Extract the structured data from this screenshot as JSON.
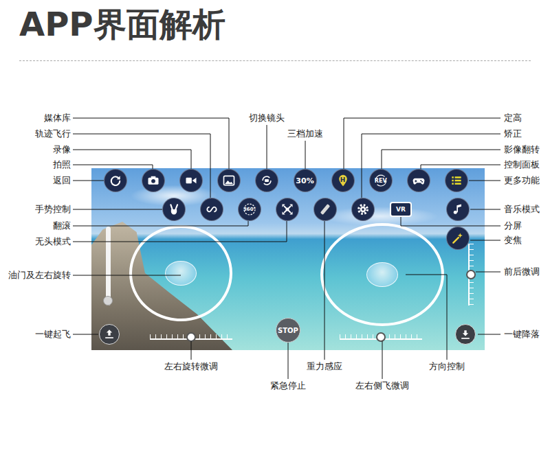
{
  "title": "APP界面解析",
  "callouts": [
    "媒体库",
    "轨迹飞行",
    "录像",
    "拍照",
    "返回",
    "手势控制",
    "翻滚",
    "无头模式",
    "油门及左右旋转",
    "一键起飞",
    "切换镜头",
    "三档加速",
    "定高",
    "矫正",
    "影像翻转",
    "控制面板",
    "更多功能",
    "音乐模式",
    "分屏",
    "变焦",
    "前后微调",
    "一键降落",
    "左右旋转微调",
    "紧急停止",
    "重力感应",
    "左右侧飞微调",
    "方向控制"
  ],
  "top_buttons": [
    {
      "kind": "back"
    },
    {
      "kind": "photo"
    },
    {
      "kind": "video"
    },
    {
      "kind": "media"
    },
    {
      "kind": "camera-switch"
    },
    {
      "kind": "speed",
      "text": "30%"
    },
    {
      "kind": "altitude",
      "text": "H"
    },
    {
      "kind": "rev",
      "text": "REV"
    },
    {
      "kind": "gamepad"
    },
    {
      "kind": "menu"
    }
  ],
  "second_buttons": [
    {
      "kind": "gesture"
    },
    {
      "kind": "track"
    },
    {
      "kind": "flip",
      "text": "360°"
    },
    {
      "kind": "headless"
    },
    {
      "kind": "gravity"
    },
    {
      "kind": "calibrate"
    },
    {
      "kind": "vr",
      "text": "VR"
    }
  ],
  "side_buttons": [
    {
      "kind": "music"
    },
    {
      "kind": "zoom"
    }
  ],
  "stop_button": {
    "text": "STOP"
  },
  "takeoff_button": {
    "kind": "takeoff"
  },
  "land_button": {
    "kind": "land"
  },
  "throttle": {
    "level": 0
  },
  "rotate_trim": {
    "level": 0.5
  },
  "side_trim": {
    "level": 0.5
  },
  "pitch_trim": {
    "level": 0.5
  }
}
